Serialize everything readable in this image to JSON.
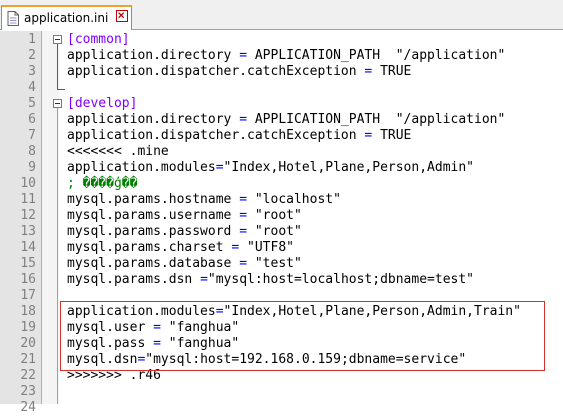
{
  "tab": {
    "label": "application.ini"
  },
  "lines": [
    {
      "n": "1",
      "parts": [
        [
          "sec",
          "[common]"
        ]
      ]
    },
    {
      "n": "2",
      "parts": [
        [
          "key",
          "application.directory "
        ],
        [
          "op",
          "= "
        ],
        [
          "str",
          "APPLICATION_PATH  \"/application\""
        ]
      ]
    },
    {
      "n": "3",
      "parts": [
        [
          "key",
          "application.dispatcher.catchException "
        ],
        [
          "op",
          "= "
        ],
        [
          "str",
          "TRUE"
        ]
      ]
    },
    {
      "n": "4",
      "parts": []
    },
    {
      "n": "5",
      "parts": [
        [
          "sec",
          "[develop]"
        ]
      ]
    },
    {
      "n": "6",
      "parts": [
        [
          "key",
          "application.directory "
        ],
        [
          "op",
          "= "
        ],
        [
          "str",
          "APPLICATION_PATH  \"/application\""
        ]
      ]
    },
    {
      "n": "7",
      "parts": [
        [
          "key",
          "application.dispatcher.catchException "
        ],
        [
          "op",
          "= "
        ],
        [
          "str",
          "TRUE"
        ]
      ]
    },
    {
      "n": "8",
      "parts": [
        [
          "key",
          "<<<<<<< .mine"
        ]
      ]
    },
    {
      "n": "9",
      "parts": [
        [
          "key",
          "application.modules"
        ],
        [
          "op",
          "="
        ],
        [
          "str",
          "\"Index,Hotel,Plane,Person,Admin\""
        ]
      ]
    },
    {
      "n": "10",
      "parts": [
        [
          "cmt",
          "; ����ģ��"
        ]
      ]
    },
    {
      "n": "11",
      "parts": [
        [
          "key",
          "mysql.params.hostname "
        ],
        [
          "op",
          "= "
        ],
        [
          "str",
          "\"localhost\""
        ]
      ]
    },
    {
      "n": "12",
      "parts": [
        [
          "key",
          "mysql.params.username "
        ],
        [
          "op",
          "= "
        ],
        [
          "str",
          "\"root\""
        ]
      ]
    },
    {
      "n": "13",
      "parts": [
        [
          "key",
          "mysql.params.password "
        ],
        [
          "op",
          "= "
        ],
        [
          "str",
          "\"root\""
        ]
      ]
    },
    {
      "n": "14",
      "parts": [
        [
          "key",
          "mysql.params.charset "
        ],
        [
          "op",
          "= "
        ],
        [
          "str",
          "\"UTF8\""
        ]
      ]
    },
    {
      "n": "15",
      "parts": [
        [
          "key",
          "mysql.params.database "
        ],
        [
          "op",
          "= "
        ],
        [
          "str",
          "\"test\""
        ]
      ]
    },
    {
      "n": "16",
      "parts": [
        [
          "key",
          "mysql.params.dsn "
        ],
        [
          "op",
          "="
        ],
        [
          "str",
          "\"mysql:host=localhost;dbname=test\""
        ]
      ]
    },
    {
      "n": "17",
      "parts": []
    },
    {
      "n": "18",
      "parts": [
        [
          "key",
          "application.modules"
        ],
        [
          "op",
          "="
        ],
        [
          "str",
          "\"Index,Hotel,Plane,Person,Admin,Train\""
        ]
      ]
    },
    {
      "n": "19",
      "parts": [
        [
          "key",
          "mysql.user "
        ],
        [
          "op",
          "= "
        ],
        [
          "str",
          "\"fanghua\""
        ]
      ]
    },
    {
      "n": "20",
      "parts": [
        [
          "key",
          "mysql.pass "
        ],
        [
          "op",
          "= "
        ],
        [
          "str",
          "\"fanghua\""
        ]
      ]
    },
    {
      "n": "21",
      "parts": [
        [
          "key",
          "mysql.dsn"
        ],
        [
          "op",
          "="
        ],
        [
          "str",
          "\"mysql:host=192.168.0.159;dbname=service\""
        ]
      ]
    },
    {
      "n": "22",
      "parts": [
        [
          "key",
          ">>>>>>> .r46"
        ]
      ]
    },
    {
      "n": "23",
      "parts": []
    },
    {
      "n": "24",
      "parts": []
    }
  ],
  "colors": {
    "section": "#8000ff",
    "operator": "#0000ff",
    "comment": "#008000",
    "highlight": "#d32f2f"
  }
}
